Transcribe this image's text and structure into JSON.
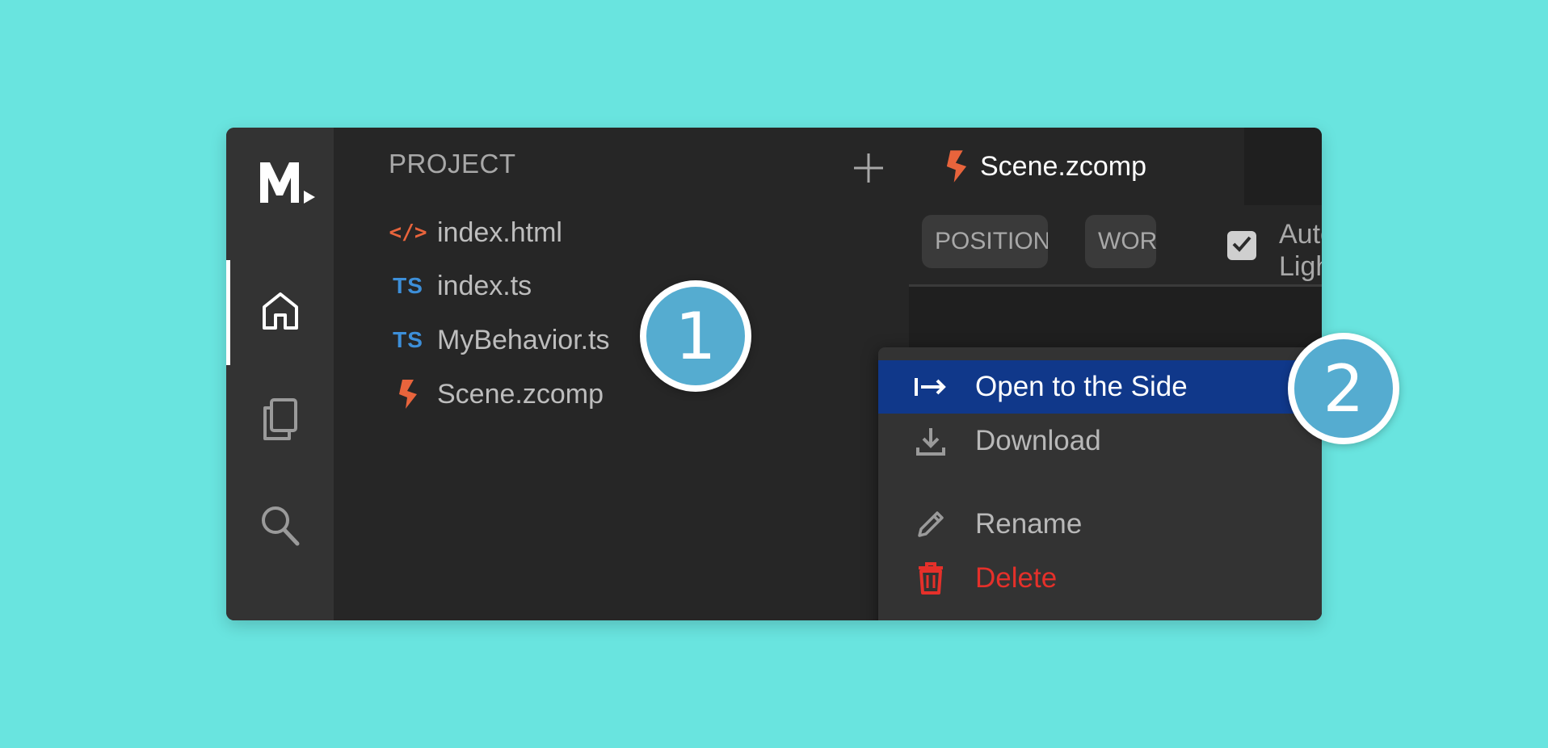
{
  "colors": {
    "background": "#69e4df",
    "window": "#262626",
    "activity_bar": "#333333",
    "accent_orange": "#e8643c",
    "ts_blue": "#3d8fd9",
    "menu_highlight": "#10388a",
    "danger": "#e5302a",
    "badge": "#55acd0"
  },
  "activity_bar": {
    "logo_text": "M",
    "items": [
      {
        "icon": "home-icon",
        "active": true
      },
      {
        "icon": "files-icon",
        "active": false
      },
      {
        "icon": "search-icon",
        "active": false
      }
    ]
  },
  "project": {
    "title": "PROJECT",
    "add_icon": "plus-icon",
    "files": [
      {
        "label": "index.html",
        "icon": "html-file-icon",
        "icon_text": "</>"
      },
      {
        "label": "index.ts",
        "icon": "ts-file-icon",
        "icon_text": "TS"
      },
      {
        "label": "MyBehavior.ts",
        "icon": "ts-file-icon",
        "icon_text": "TS"
      },
      {
        "label": "Scene.zcomp",
        "icon": "zcomp-file-icon",
        "icon_text": ""
      }
    ]
  },
  "editor": {
    "tab": {
      "label": "Scene.zcomp",
      "icon": "zcomp-file-icon"
    },
    "toolbar": {
      "position_button": "POSITION",
      "world_button": "WORLD",
      "auto_checkbox_checked": true,
      "auto_label_line1": "Auto",
      "auto_label_line2": "Lighting"
    }
  },
  "context_menu": {
    "items": [
      {
        "label": "Open to the Side",
        "icon": "open-side-icon",
        "highlighted": true
      },
      {
        "label": "Download",
        "icon": "download-icon"
      },
      {
        "label": "Rename",
        "icon": "pencil-icon"
      },
      {
        "label": "Delete",
        "icon": "trash-icon",
        "danger": true
      }
    ]
  },
  "callouts": {
    "first": "1",
    "second": "2"
  }
}
